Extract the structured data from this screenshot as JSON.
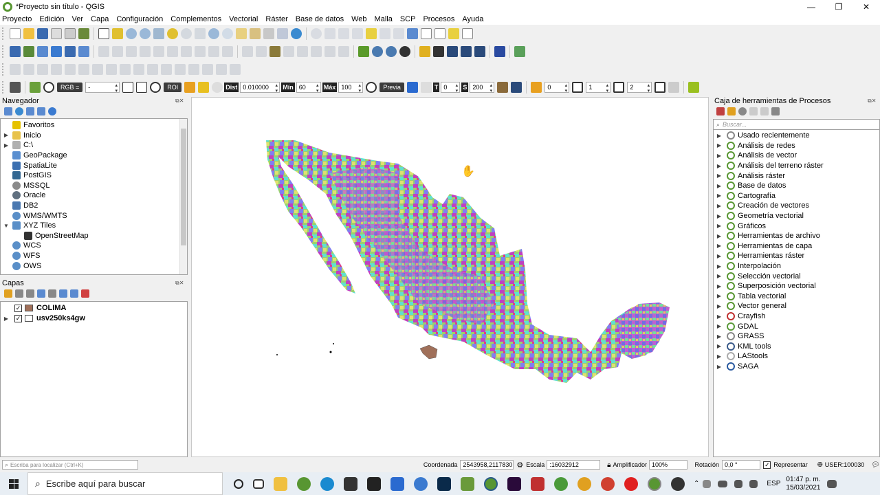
{
  "window": {
    "title": "*Proyecto sin título - QGIS",
    "controls": [
      "—",
      "❐",
      "✕"
    ]
  },
  "menu": [
    "Proyecto",
    "Edición",
    "Ver",
    "Capa",
    "Configuración",
    "Complementos",
    "Vectorial",
    "Ráster",
    "Base de datos",
    "Web",
    "Malla",
    "SCP",
    "Procesos",
    "Ayuda"
  ],
  "scp_toolbar": {
    "rgb_label": "RGB =",
    "rgb_value": "-",
    "roi_label": "ROI",
    "dist_label": "Dist",
    "dist_value": "0.010000",
    "min_label": "Mín",
    "min_value": "60",
    "max_label": "Máx",
    "max_value": "100",
    "previa_label": "Previa",
    "t_label": "T",
    "t_value": "0",
    "s_label": "S",
    "s_value": "200",
    "band1_value": "0",
    "band2_value": "1",
    "band3_value": "2"
  },
  "navigator": {
    "title": "Navegador",
    "items": [
      {
        "label": "Favoritos",
        "icon": "star-icon",
        "color": "#e6c200",
        "expand": false
      },
      {
        "label": "Inicio",
        "icon": "folder-icon",
        "color": "#e8c24a",
        "expand": true
      },
      {
        "label": "C:\\",
        "icon": "drive-icon",
        "color": "#b0b0b0",
        "expand": true
      },
      {
        "label": "GeoPackage",
        "icon": "geopackage-icon",
        "color": "#5a8fd0",
        "expand": false
      },
      {
        "label": "SpatiaLite",
        "icon": "spatialite-icon",
        "color": "#3b6fb0",
        "expand": false
      },
      {
        "label": "PostGIS",
        "icon": "postgis-icon",
        "color": "#336791",
        "expand": false
      },
      {
        "label": "MSSQL",
        "icon": "mssql-icon",
        "color": "#8a8a8a",
        "expand": false
      },
      {
        "label": "Oracle",
        "icon": "oracle-icon",
        "color": "#607080",
        "expand": false
      },
      {
        "label": "DB2",
        "icon": "db2-icon",
        "color": "#4a78b0",
        "expand": false
      },
      {
        "label": "WMS/WMTS",
        "icon": "globe-icon",
        "color": "#5a8fc8",
        "expand": false
      },
      {
        "label": "XYZ Tiles",
        "icon": "xyz-tiles-icon",
        "color": "#5a8fc8",
        "expand": true
      },
      {
        "label": "OpenStreetMap",
        "icon": "osm-icon",
        "color": "#333333",
        "expand": false
      },
      {
        "label": "WCS",
        "icon": "globe-icon",
        "color": "#5a8fc8",
        "expand": false
      },
      {
        "label": "WFS",
        "icon": "wfs-icon",
        "color": "#5a8fc8",
        "expand": false
      },
      {
        "label": "OWS",
        "icon": "globe-icon",
        "color": "#5a8fc8",
        "expand": false
      }
    ]
  },
  "layers": {
    "title": "Capas",
    "items": [
      {
        "label": "COLIMA",
        "checked": "✓",
        "swatch": "#a0705a"
      },
      {
        "label": "usv250ks4gw",
        "checked": "✓",
        "swatch": "#ffffff"
      }
    ]
  },
  "processing": {
    "title": "Caja de herramientas de Procesos",
    "search_placeholder": "Buscar...",
    "items": [
      {
        "label": "Usado recientemente",
        "icon": "clock-icon",
        "color": "#888888"
      },
      {
        "label": "Análisis de redes",
        "icon": "qgis-icon",
        "color": "#589632"
      },
      {
        "label": "Análisis de vector",
        "icon": "qgis-icon",
        "color": "#589632"
      },
      {
        "label": "Análisis del terreno ráster",
        "icon": "qgis-icon",
        "color": "#589632"
      },
      {
        "label": "Análisis ráster",
        "icon": "qgis-icon",
        "color": "#589632"
      },
      {
        "label": "Base de datos",
        "icon": "qgis-icon",
        "color": "#589632"
      },
      {
        "label": "Cartografía",
        "icon": "qgis-icon",
        "color": "#589632"
      },
      {
        "label": "Creación de vectores",
        "icon": "qgis-icon",
        "color": "#589632"
      },
      {
        "label": "Geometría vectorial",
        "icon": "qgis-icon",
        "color": "#589632"
      },
      {
        "label": "Gráficos",
        "icon": "qgis-icon",
        "color": "#589632"
      },
      {
        "label": "Herramientas de archivo",
        "icon": "qgis-icon",
        "color": "#589632"
      },
      {
        "label": "Herramientas de capa",
        "icon": "qgis-icon",
        "color": "#589632"
      },
      {
        "label": "Herramientas ráster",
        "icon": "qgis-icon",
        "color": "#589632"
      },
      {
        "label": "Interpolación",
        "icon": "qgis-icon",
        "color": "#589632"
      },
      {
        "label": "Selección vectorial",
        "icon": "qgis-icon",
        "color": "#589632"
      },
      {
        "label": "Superposición vectorial",
        "icon": "qgis-icon",
        "color": "#589632"
      },
      {
        "label": "Tabla vectorial",
        "icon": "qgis-icon",
        "color": "#589632"
      },
      {
        "label": "Vector general",
        "icon": "qgis-icon",
        "color": "#589632"
      },
      {
        "label": "Crayfish",
        "icon": "crayfish-icon",
        "color": "#c03030"
      },
      {
        "label": "GDAL",
        "icon": "gdal-icon",
        "color": "#5a9a3a"
      },
      {
        "label": "GRASS",
        "icon": "grass-icon",
        "color": "#888888"
      },
      {
        "label": "KML tools",
        "icon": "kml-icon",
        "color": "#3a5a8a"
      },
      {
        "label": "LAStools",
        "icon": "lastools-icon",
        "color": "#aaaaaa"
      },
      {
        "label": "SAGA",
        "icon": "saga-icon",
        "color": "#2a5aa0"
      }
    ]
  },
  "status": {
    "locator_placeholder": "Escriba para localizar (Ctrl+K)",
    "coord_label": "Coordenada",
    "coord_value": "2543958,2117830",
    "scale_label": "Escala",
    "scale_value": ":16032912",
    "magnifier_label": "Amplificador",
    "magnifier_value": "100%",
    "rotation_label": "Rotación",
    "rotation_value": "0,0 °",
    "render_label": "Representar",
    "render_checked": "✓",
    "crs_value": "USER:100030"
  },
  "taskbar": {
    "search_text": "Escribe aquí para buscar",
    "lang": "ESP",
    "time": "01:47 p. m.",
    "date": "15/03/2021"
  },
  "colors": {
    "qgis_green": "#589632",
    "map_bg": "#ffffff",
    "colima": "#a0705a"
  }
}
